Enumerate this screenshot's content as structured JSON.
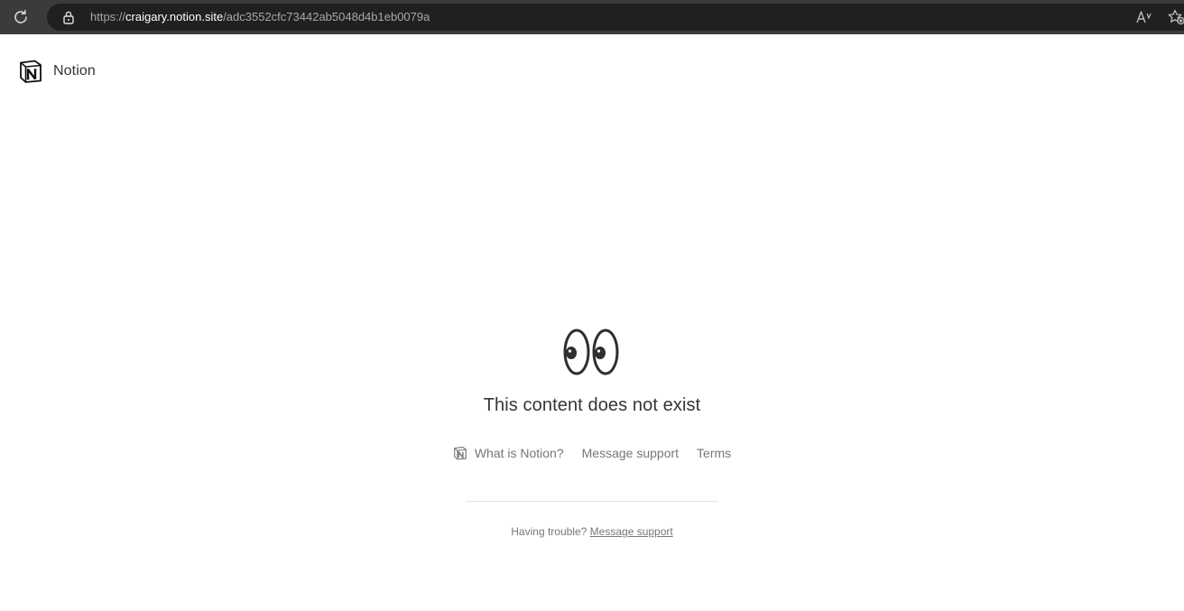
{
  "browser": {
    "url_scheme": "https://",
    "url_host": "craigary.notion.site",
    "url_path": "/adc3552cfc73442ab5048d4b1eb0079a",
    "read_aloud_label": "Á"
  },
  "header": {
    "brand": "Notion"
  },
  "main": {
    "message": "This content does not exist",
    "links": {
      "what_is_notion": "What is Notion?",
      "message_support": "Message support",
      "terms": "Terms"
    },
    "trouble": {
      "prefix": "Having trouble?",
      "link": "Message support"
    }
  },
  "colors": {
    "text": "#37352f",
    "muted": "#787774",
    "chrome": "#3b3b3b",
    "address_bg": "#202020"
  }
}
